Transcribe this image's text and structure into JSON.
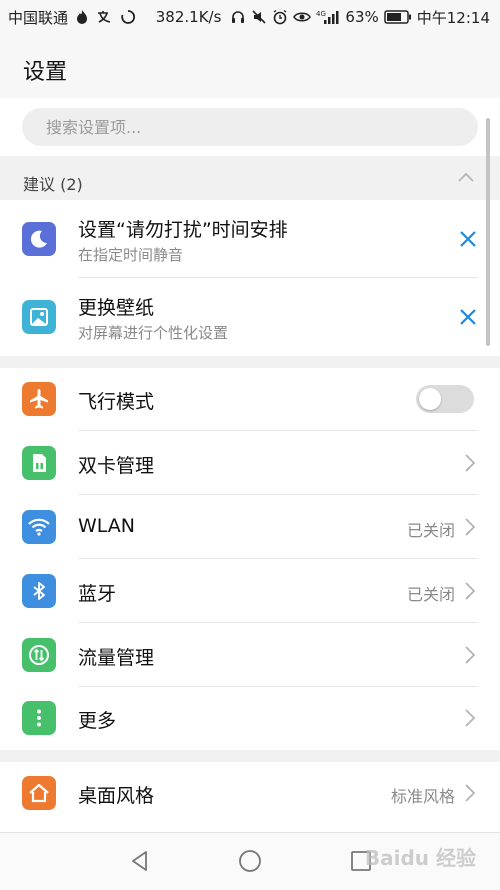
{
  "status_bar": {
    "carrier": "中国联通",
    "net_speed": "382.1K/s",
    "battery": "63%",
    "network_type": "4G",
    "time": "中午12:14"
  },
  "header": {
    "title": "设置"
  },
  "search": {
    "placeholder": "搜索设置项..."
  },
  "suggestions": {
    "title": "建议 (2)",
    "items": [
      {
        "label": "设置“请勿打扰”时间安排",
        "sub": "在指定时间静音",
        "icon": "moon-icon",
        "color": "#5b6fd8"
      },
      {
        "label": "更换壁纸",
        "sub": "对屏幕进行个性化设置",
        "icon": "wallpaper-icon",
        "color": "#3fb3d6"
      }
    ]
  },
  "settings": {
    "items": [
      {
        "label": "飞行模式",
        "icon": "airplane-icon",
        "color": "#ee7a30",
        "control": "toggle",
        "toggle_on": false
      },
      {
        "label": "双卡管理",
        "icon": "sim-card-icon",
        "color": "#46c06a",
        "control": "chevron"
      },
      {
        "label": "WLAN",
        "value": "已关闭",
        "icon": "wifi-icon",
        "color": "#3e8fe0",
        "control": "chevron"
      },
      {
        "label": "蓝牙",
        "value": "已关闭",
        "icon": "bluetooth-icon",
        "color": "#3e8fe0",
        "control": "chevron"
      },
      {
        "label": "流量管理",
        "icon": "data-usage-icon",
        "color": "#46c06a",
        "control": "chevron"
      },
      {
        "label": "更多",
        "icon": "more-icon",
        "color": "#46c06a",
        "control": "chevron"
      }
    ],
    "items2": [
      {
        "label": "桌面风格",
        "value": "标准风格",
        "icon": "home-style-icon",
        "color": "#ee7a30",
        "control": "chevron"
      }
    ]
  },
  "watermark": {
    "text": "Baidu 经验"
  },
  "colors": {
    "accent": "#1e88e5",
    "background": "#f1f1f1"
  }
}
